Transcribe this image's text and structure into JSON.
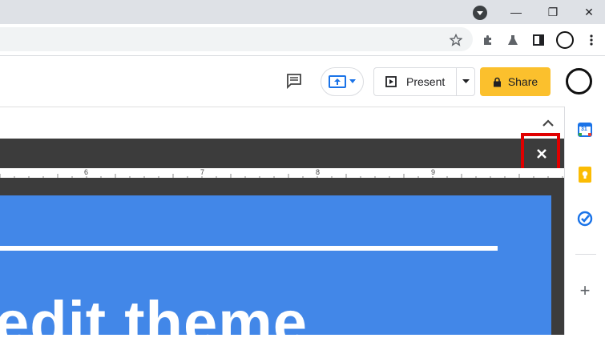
{
  "browser": {
    "window_controls": {
      "minimize": "—",
      "restore": "❐",
      "close": "✕"
    }
  },
  "toolbar": {
    "present_label": "Present",
    "share_label": "Share"
  },
  "ruler": {
    "labels": [
      "6",
      "7",
      "8",
      "9"
    ]
  },
  "slide": {
    "title_text": "edit theme"
  },
  "side_panel": {
    "calendar_day": "31",
    "add_label": "+"
  },
  "colors": {
    "share": "#fbc02d",
    "slide_bg": "#4287e8",
    "highlight": "#e00000",
    "dark_area": "#3c3c3c"
  }
}
